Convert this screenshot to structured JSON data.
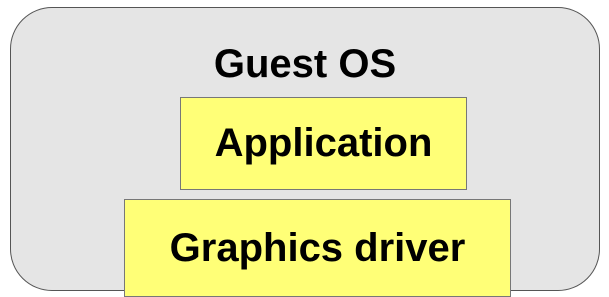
{
  "diagram": {
    "container": {
      "label": "Guest OS",
      "fill": "#e5e5e5",
      "border": "#555555"
    },
    "layers": [
      {
        "label": "Application",
        "fill": "#ffff77"
      },
      {
        "label": "Graphics driver",
        "fill": "#ffff77"
      }
    ]
  }
}
